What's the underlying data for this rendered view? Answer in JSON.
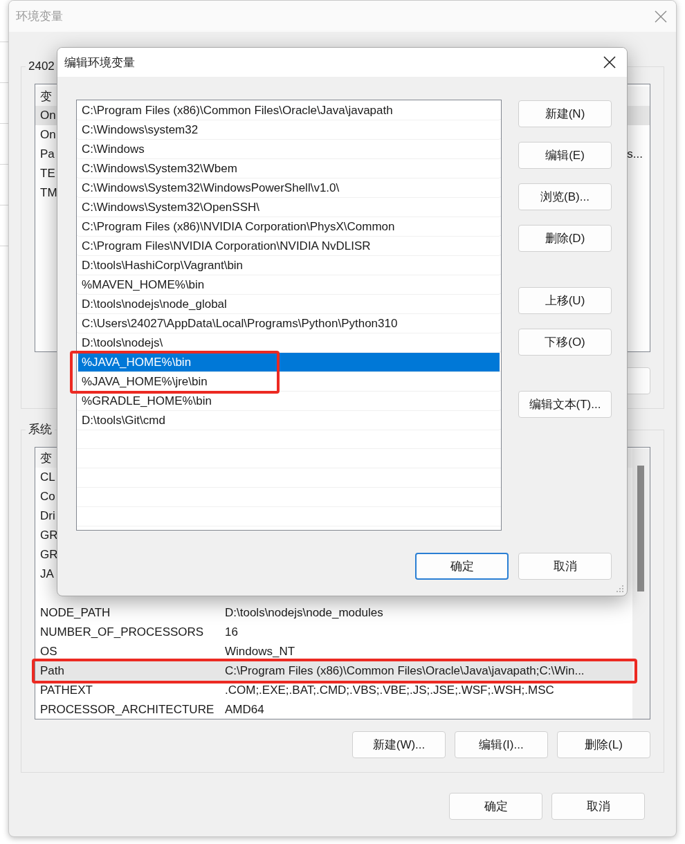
{
  "window": {
    "title": "环境变量",
    "active": false
  },
  "user_variables": {
    "label": "2402",
    "header": "变",
    "rows": [
      {
        "name": "On",
        "selected": true
      },
      {
        "name": "On",
        "selected": false
      },
      {
        "name": "Pa",
        "value_end": "s...",
        "selected": false
      },
      {
        "name": "TE",
        "selected": false
      },
      {
        "name": "TM",
        "selected": false
      }
    ]
  },
  "system_variables": {
    "label": "系统",
    "header": "变",
    "rows": [
      {
        "name": "CL",
        "selected": false,
        "annotated": false
      },
      {
        "name": "Co",
        "selected": false,
        "annotated": false
      },
      {
        "name": "Dri",
        "selected": false,
        "annotated": false
      },
      {
        "name": "GR",
        "selected": false,
        "annotated": false
      },
      {
        "name": "GR",
        "selected": false,
        "annotated": false
      },
      {
        "name": "JA",
        "selected": false,
        "annotated": false
      },
      {
        "selected": false,
        "annotated": false
      },
      {
        "name": "NODE_PATH",
        "value": "D:\\tools\\nodejs\\node_modules",
        "selected": false,
        "annotated": false
      },
      {
        "name": "NUMBER_OF_PROCESSORS",
        "value": "16",
        "selected": false,
        "annotated": false
      },
      {
        "name": "OS",
        "value": "Windows_NT",
        "selected": false,
        "annotated": false
      },
      {
        "name": "Path",
        "value": "C:\\Program Files (x86)\\Common Files\\Oracle\\Java\\javapath;C:\\Win...",
        "selected": true,
        "annotated": true
      },
      {
        "name": "PATHEXT",
        "value": ".COM;.EXE;.BAT;.CMD;.VBS;.VBE;.JS;.JSE;.WSF;.WSH;.MSC",
        "selected": false,
        "annotated": false
      },
      {
        "name": "PROCESSOR_ARCHITECTURE",
        "value": "AMD64",
        "selected": false,
        "annotated": false
      }
    ],
    "buttons": [
      "新建(W)...",
      "编辑(I)...",
      "删除(L)"
    ]
  },
  "buttons": [
    "确定",
    "取消"
  ],
  "dialog": {
    "title": "编辑环境变量",
    "items": [
      {
        "text": "C:\\Program Files (x86)\\Common Files\\Oracle\\Java\\javapath",
        "selected": false,
        "annotated": false
      },
      {
        "text": "C:\\Windows\\system32",
        "selected": false,
        "annotated": false
      },
      {
        "text": "C:\\Windows",
        "selected": false,
        "annotated": false
      },
      {
        "text": "C:\\Windows\\System32\\Wbem",
        "selected": false,
        "annotated": false
      },
      {
        "text": "C:\\Windows\\System32\\WindowsPowerShell\\v1.0\\",
        "selected": false,
        "annotated": false
      },
      {
        "text": "C:\\Windows\\System32\\OpenSSH\\",
        "selected": false,
        "annotated": false
      },
      {
        "text": "C:\\Program Files (x86)\\NVIDIA Corporation\\PhysX\\Common",
        "selected": false,
        "annotated": false
      },
      {
        "text": "C:\\Program Files\\NVIDIA Corporation\\NVIDIA NvDLISR",
        "selected": false,
        "annotated": false
      },
      {
        "text": "D:\\tools\\HashiCorp\\Vagrant\\bin",
        "selected": false,
        "annotated": false
      },
      {
        "text": "%MAVEN_HOME%\\bin",
        "selected": false,
        "annotated": false
      },
      {
        "text": "D:\\tools\\nodejs\\node_global",
        "selected": false,
        "annotated": false
      },
      {
        "text": "C:\\Users\\24027\\AppData\\Local\\Programs\\Python\\Python310",
        "selected": false,
        "annotated": false
      },
      {
        "text": "D:\\tools\\nodejs\\",
        "selected": false,
        "annotated": false
      },
      {
        "text": "%JAVA_HOME%\\bin",
        "selected": true,
        "annotated": true
      },
      {
        "text": "%JAVA_HOME%\\jre\\bin",
        "selected": false,
        "annotated": true
      },
      {
        "text": "%GRADLE_HOME%\\bin",
        "selected": false,
        "annotated": false
      },
      {
        "text": "D:\\tools\\Git\\cmd",
        "selected": false,
        "annotated": false
      }
    ],
    "button_groups": [
      [
        "新建(N)",
        "编辑(E)",
        "浏览(B)...",
        "删除(D)"
      ],
      [
        "上移(U)",
        "下移(O)"
      ],
      [
        "编辑文本(T)..."
      ]
    ],
    "buttons": [
      {
        "label": "确定",
        "default": true
      },
      {
        "label": "取消",
        "default": false
      }
    ]
  }
}
